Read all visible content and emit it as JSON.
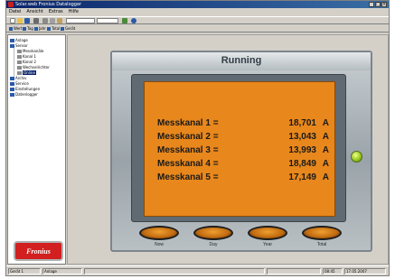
{
  "window": {
    "title": "Solar.web Fronius Datalogger",
    "controls": [
      "_",
      "□",
      "×"
    ]
  },
  "menu": [
    "Datei",
    "Ansicht",
    "Extras",
    "Hilfe"
  ],
  "toolbar": {
    "field_value": "",
    "icons": [
      "new-icon",
      "open-icon",
      "save-icon",
      "print-icon",
      "cut-icon",
      "copy-icon",
      "paste-icon",
      "refresh-icon",
      "help-icon"
    ]
  },
  "toolbar2": {
    "items": [
      "Wert",
      "Tag",
      "Jahr",
      "Total",
      "Gerät"
    ]
  },
  "sidebar": {
    "tree": [
      {
        "label": "Anlage",
        "indent": 0,
        "color": "#2a5aa8"
      },
      {
        "label": "Sensor",
        "indent": 0,
        "color": "#2a5aa8"
      },
      {
        "label": "Messkanäle",
        "indent": 1,
        "color": "#8a8a8a"
      },
      {
        "label": "Kanal 1",
        "indent": 1,
        "color": "#8a8a8a"
      },
      {
        "label": "Kanal 2",
        "indent": 1,
        "color": "#8a8a8a"
      },
      {
        "label": "Wechselrichter",
        "indent": 1,
        "color": "#8a8a8a"
      },
      {
        "label": "Online",
        "indent": 1,
        "color": "#8a8a8a",
        "selected": true
      },
      {
        "label": "Archiv",
        "indent": 0,
        "color": "#2a5aa8"
      },
      {
        "label": "Service",
        "indent": 0,
        "color": "#2a5aa8"
      },
      {
        "label": "Einstellungen",
        "indent": 0,
        "color": "#2a5aa8"
      },
      {
        "label": "Datenlogger",
        "indent": 0,
        "color": "#2a5aa8"
      }
    ],
    "logo_text": "Fronius"
  },
  "device": {
    "status_title": "Running",
    "led_color": "#8ec216",
    "screen_color": "#e8871c",
    "measurements": [
      {
        "label": "Messkanal 1 =",
        "value": "18,701",
        "unit": "A"
      },
      {
        "label": "Messkanal 2 =",
        "value": "13,043",
        "unit": "A"
      },
      {
        "label": "Messkanal 3 =",
        "value": "13,993",
        "unit": "A"
      },
      {
        "label": "Messkanal 4 =",
        "value": "18,849",
        "unit": "A"
      },
      {
        "label": "Messkanal 5 =",
        "value": "17,149",
        "unit": "A"
      }
    ],
    "buttons": [
      "Now",
      "Day",
      "Year",
      "Total"
    ]
  },
  "statusbar": {
    "cells": [
      "Gerät 1",
      "Anlage",
      "",
      "",
      "08:45",
      "17.05.2007"
    ]
  }
}
